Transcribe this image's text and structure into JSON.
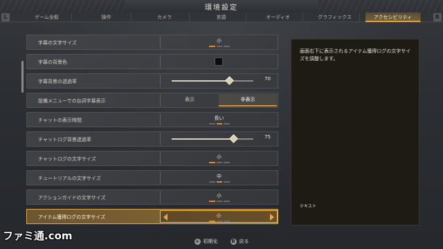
{
  "window": {
    "title": "環境設定"
  },
  "shoulders": {
    "left": "L",
    "right": "R"
  },
  "tabs": [
    {
      "label": "ゲーム全般",
      "active": false
    },
    {
      "label": "操作",
      "active": false
    },
    {
      "label": "カメラ",
      "active": false
    },
    {
      "label": "言語",
      "active": false
    },
    {
      "label": "オーディオ",
      "active": false
    },
    {
      "label": "グラフィックス",
      "active": false
    },
    {
      "label": "アクセシビリティ",
      "active": true
    }
  ],
  "settings": [
    {
      "label": "字幕の文字サイズ",
      "type": "selector",
      "value": "小"
    },
    {
      "label": "字幕の背景色",
      "type": "color",
      "value_color": "#0c0c0c"
    },
    {
      "label": "字幕背景の透過率",
      "type": "slider",
      "value": "70",
      "level": 0.7
    },
    {
      "label": "設備メニューでの台詞字幕表示",
      "type": "toggle",
      "options": [
        "表示",
        "非表示"
      ],
      "selected": 1
    },
    {
      "label": "チャットの表示時間",
      "type": "selector",
      "value": "長い"
    },
    {
      "label": "チャットログ背景透過率",
      "type": "slider",
      "value": "75",
      "level": 0.75
    },
    {
      "label": "チャットログの文字サイズ",
      "type": "selector",
      "value": "小"
    },
    {
      "label": "チュートリアルの文字サイズ",
      "type": "selector",
      "value": "中"
    },
    {
      "label": "アクションガイドの文字サイズ",
      "type": "selector",
      "value": "小"
    },
    {
      "label": "アイテム獲得ログの文字サイズ",
      "type": "selector",
      "value": "小",
      "selected": true
    }
  ],
  "description": {
    "text": "画面右下に表示されるアイテム獲得ログの文字サイズを調整します。",
    "preview": "テキスト"
  },
  "footer": {
    "reset_label": "初期化",
    "back_label": "戻る"
  },
  "watermark": "ファミ通.com",
  "colors": {
    "accent": "#e08a2a",
    "selected_row": "#8a6a34"
  }
}
